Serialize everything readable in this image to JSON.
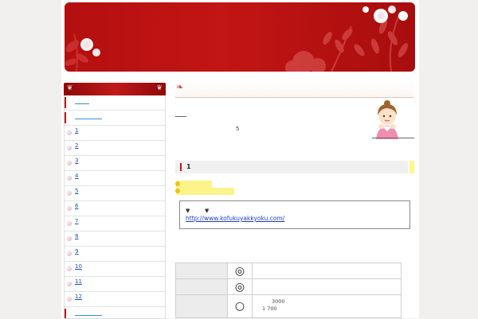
{
  "sidebar": {
    "items": [
      {
        "label": "",
        "style": "bar"
      },
      {
        "label": "",
        "style": "bar"
      },
      {
        "label": "1",
        "style": "dot"
      },
      {
        "label": "2",
        "style": "dot"
      },
      {
        "label": "3",
        "style": "dot"
      },
      {
        "label": "4",
        "style": "dot"
      },
      {
        "label": "5",
        "style": "dot"
      },
      {
        "label": "6",
        "style": "dot"
      },
      {
        "label": "7",
        "style": "dot"
      },
      {
        "label": "8",
        "style": "dot"
      },
      {
        "label": "9",
        "style": "dot"
      },
      {
        "label": "10",
        "style": "dot"
      },
      {
        "label": "11",
        "style": "dot"
      },
      {
        "label": "12",
        "style": "dot"
      },
      {
        "label": "",
        "style": "bar"
      }
    ]
  },
  "main": {
    "intro_number": "5",
    "section_number": "1",
    "arrows": [
      "▼",
      "▼"
    ],
    "link_url": "http://www.kofukuyakkyoku.com/",
    "table": {
      "rows": [
        {
          "mark": "◎",
          "line1": "",
          "line2": ""
        },
        {
          "mark": "◎",
          "line1": "",
          "line2": ""
        },
        {
          "mark": "○",
          "line1": "3000",
          "line2": "1 700"
        }
      ]
    }
  },
  "colors": {
    "banner_red": "#b40f0f",
    "accent_red": "#c01515",
    "highlight_yellow": "#fbf48a",
    "link_blue": "#1a3fc4"
  }
}
